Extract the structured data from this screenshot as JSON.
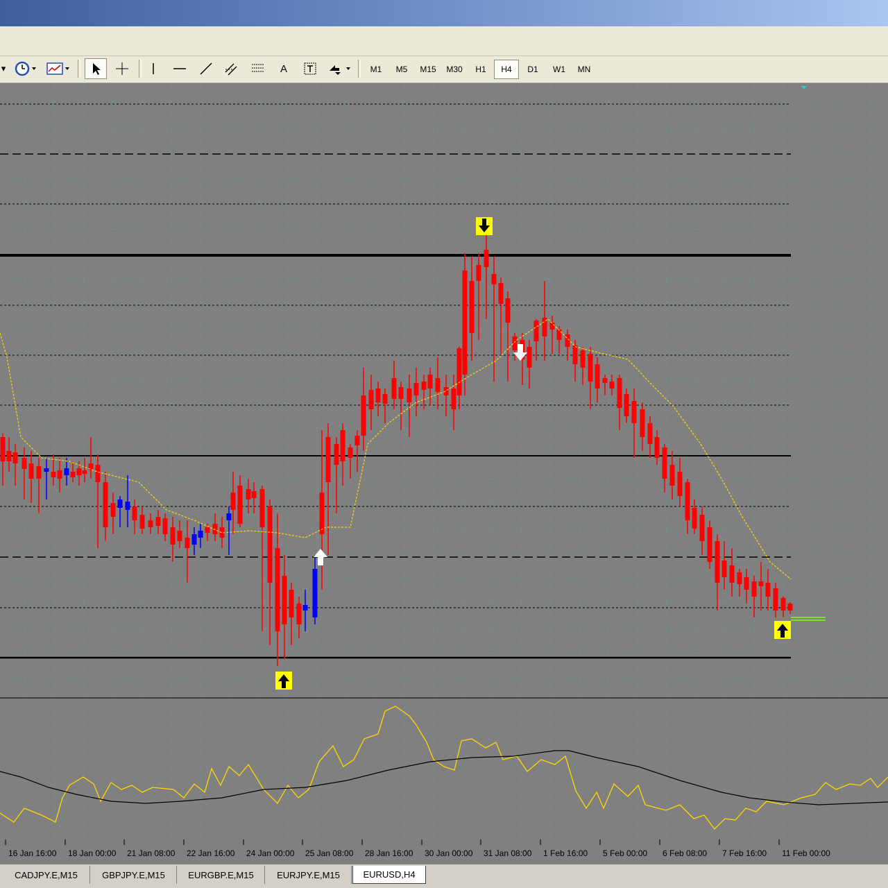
{
  "toolbar": {
    "timeframes": [
      {
        "label": "M1",
        "active": false
      },
      {
        "label": "M5",
        "active": false
      },
      {
        "label": "M15",
        "active": false
      },
      {
        "label": "M30",
        "active": false
      },
      {
        "label": "H1",
        "active": false
      },
      {
        "label": "H4",
        "active": true
      },
      {
        "label": "D1",
        "active": false
      },
      {
        "label": "W1",
        "active": false
      },
      {
        "label": "MN",
        "active": false
      }
    ],
    "text_tool_label": "A"
  },
  "chart": {
    "time_labels": [
      "16 Jan 16:00",
      "18 Jan 00:00",
      "21 Jan 08:00",
      "22 Jan 16:00",
      "24 Jan 00:00",
      "25 Jan 08:00",
      "28 Jan 16:00",
      "30 Jan 00:00",
      "31 Jan 08:00",
      "1 Feb 16:00",
      "5 Feb 00:00",
      "6 Feb 08:00",
      "7 Feb 16:00",
      "11 Feb 00:00"
    ],
    "colors": {
      "background": "#808080",
      "bull": "#0000ff",
      "bear": "#ff0000",
      "ma": "#ffd700",
      "grid": "#5fa0a0",
      "level": "#000000",
      "oscillator": "#ffd700",
      "signal": "#000000",
      "arrow_bg": "#ffff00"
    }
  },
  "tabs": [
    {
      "label": "CADJPY.E,M15",
      "active": false
    },
    {
      "label": "GBPJPY.E,M15",
      "active": false
    },
    {
      "label": "EURGBP.E,M15",
      "active": false
    },
    {
      "label": "EURJPY.E,M15",
      "active": false
    },
    {
      "label": "EURUSD,H4",
      "active": true
    }
  ]
}
